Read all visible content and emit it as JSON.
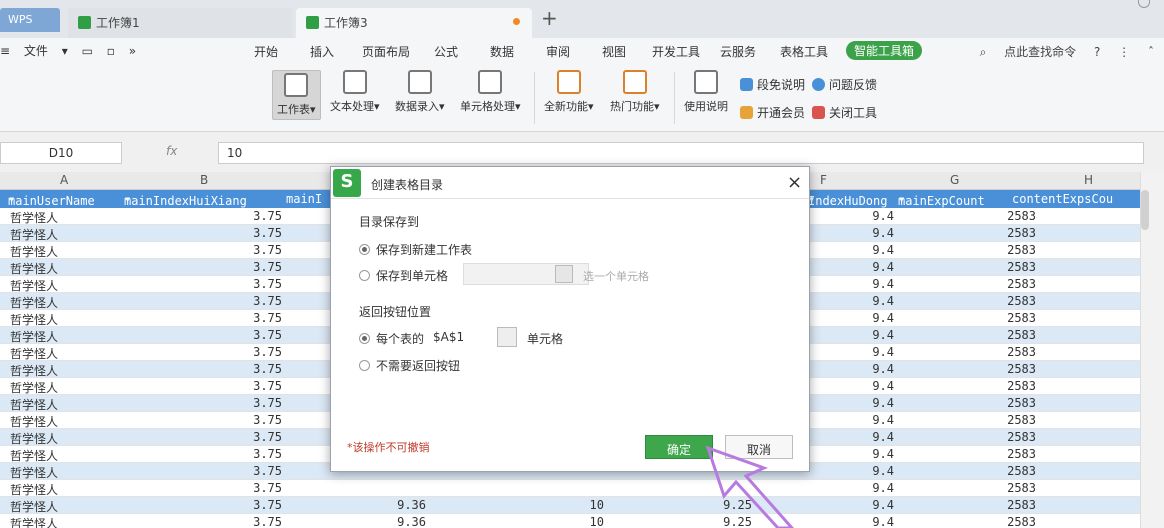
{
  "titlebar": {
    "wps_label": "WPS",
    "tabs": [
      {
        "label": "工作簿1"
      },
      {
        "label": "工作簿3"
      }
    ],
    "close_glyph": "×",
    "add_glyph": "+"
  },
  "menubar": {
    "file_label": "文件",
    "items": [
      "开始",
      "插入",
      "页面布局",
      "公式",
      "数据",
      "审阅",
      "视图",
      "开发工具",
      "云服务",
      "表格工具",
      "智能工具箱"
    ],
    "search_label": "点此查找命令"
  },
  "ribbon": {
    "buttons": [
      "工作表",
      "文本处理",
      "数据录入",
      "单元格处理",
      "全新功能",
      "热门功能",
      "使用说明"
    ],
    "small": [
      "段免说明",
      "问题反馈",
      "开通会员",
      "关闭工具"
    ]
  },
  "formula": {
    "cell_ref": "D10",
    "fx": "fx",
    "value": "10"
  },
  "sheet": {
    "columns": [
      "A",
      "B",
      "F",
      "G",
      "H"
    ],
    "headers": [
      "mainUserName",
      "mainIndexHuiXiang",
      "mainI",
      "IndexHuDong",
      "mainExpCount",
      "contentExpsCou"
    ],
    "rows": [
      {
        "name": "哲学怪人",
        "b": "3.75",
        "c": "",
        "d": "",
        "e": "",
        "f": "9.4",
        "g": "2583"
      },
      {
        "name": "哲学怪人",
        "b": "3.75",
        "c": "",
        "d": "",
        "e": "",
        "f": "9.4",
        "g": "2583"
      },
      {
        "name": "哲学怪人",
        "b": "3.75",
        "c": "",
        "d": "",
        "e": "",
        "f": "9.4",
        "g": "2583"
      },
      {
        "name": "哲学怪人",
        "b": "3.75",
        "c": "",
        "d": "",
        "e": "",
        "f": "9.4",
        "g": "2583"
      },
      {
        "name": "哲学怪人",
        "b": "3.75",
        "c": "",
        "d": "",
        "e": "",
        "f": "9.4",
        "g": "2583"
      },
      {
        "name": "哲学怪人",
        "b": "3.75",
        "c": "",
        "d": "",
        "e": "",
        "f": "9.4",
        "g": "2583"
      },
      {
        "name": "哲学怪人",
        "b": "3.75",
        "c": "",
        "d": "",
        "e": "",
        "f": "9.4",
        "g": "2583"
      },
      {
        "name": "哲学怪人",
        "b": "3.75",
        "c": "",
        "d": "",
        "e": "",
        "f": "9.4",
        "g": "2583"
      },
      {
        "name": "哲学怪人",
        "b": "3.75",
        "c": "",
        "d": "",
        "e": "",
        "f": "9.4",
        "g": "2583"
      },
      {
        "name": "哲学怪人",
        "b": "3.75",
        "c": "",
        "d": "",
        "e": "",
        "f": "9.4",
        "g": "2583"
      },
      {
        "name": "哲学怪人",
        "b": "3.75",
        "c": "",
        "d": "",
        "e": "",
        "f": "9.4",
        "g": "2583"
      },
      {
        "name": "哲学怪人",
        "b": "3.75",
        "c": "",
        "d": "",
        "e": "",
        "f": "9.4",
        "g": "2583"
      },
      {
        "name": "哲学怪人",
        "b": "3.75",
        "c": "",
        "d": "",
        "e": "",
        "f": "9.4",
        "g": "2583"
      },
      {
        "name": "哲学怪人",
        "b": "3.75",
        "c": "",
        "d": "",
        "e": "",
        "f": "9.4",
        "g": "2583"
      },
      {
        "name": "哲学怪人",
        "b": "3.75",
        "c": "",
        "d": "",
        "e": "",
        "f": "9.4",
        "g": "2583"
      },
      {
        "name": "哲学怪人",
        "b": "3.75",
        "c": "",
        "d": "",
        "e": "",
        "f": "9.4",
        "g": "2583"
      },
      {
        "name": "哲学怪人",
        "b": "3.75",
        "c": "",
        "d": "",
        "e": "",
        "f": "9.4",
        "g": "2583"
      },
      {
        "name": "哲学怪人",
        "b": "3.75",
        "c": "9.36",
        "d": "10",
        "e": "9.25",
        "f": "9.4",
        "g": "2583"
      },
      {
        "name": "哲学怪人",
        "b": "3.75",
        "c": "9.36",
        "d": "10",
        "e": "9.25",
        "f": "9.4",
        "g": "2583"
      },
      {
        "name": "哲学怪人",
        "b": "3.75",
        "c": "9.36",
        "d": "10",
        "e": "9.25",
        "f": "9.4",
        "g": "2583"
      }
    ]
  },
  "dialog": {
    "logo": "S",
    "title": "创建表格目录",
    "close_glyph": "×",
    "save_section": "目录保存到",
    "save_opt1": "保存到新建工作表",
    "save_opt2": "保存到单元格",
    "pick_hint": "选一个单元格",
    "return_section": "返回按钮位置",
    "return_opt1": "每个表的",
    "return_cell": "$A$1",
    "return_unit": "单元格",
    "return_opt2": "不需要返回按钮",
    "warning": "*该操作不可撤销",
    "ok_label": "确定",
    "cancel_label": "取消"
  }
}
